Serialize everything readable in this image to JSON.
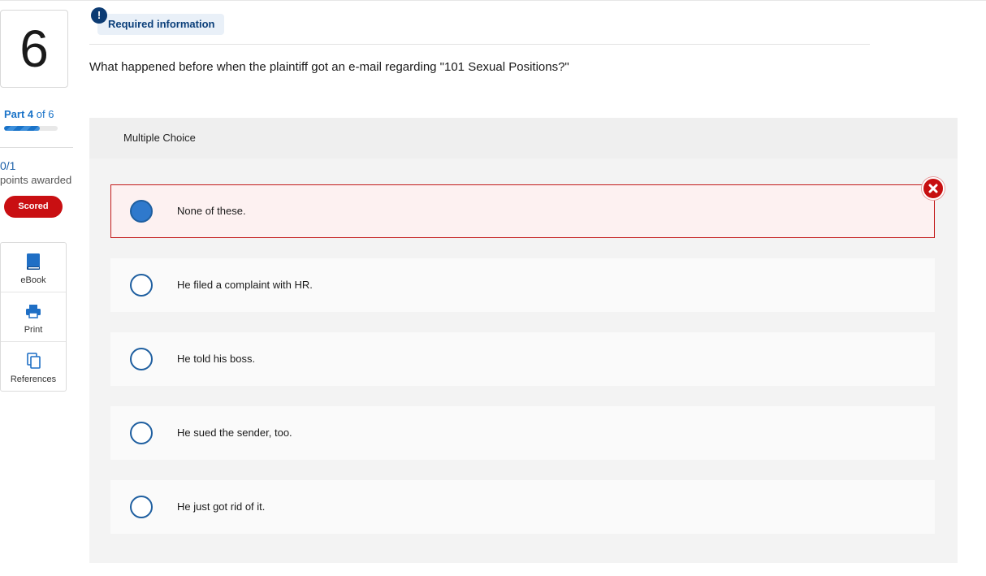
{
  "question": {
    "number": "6",
    "part_label_bold": "Part 4",
    "part_label_rest": " of 6",
    "part_progress": 0.67,
    "score": "0/1",
    "points_label": "points awarded",
    "scored_badge": "Scored",
    "required_info": "Required information",
    "text": "What happened before when the plaintiff got an e-mail regarding \"101 Sexual Positions?\""
  },
  "tools": [
    {
      "label": "eBook",
      "icon": "book-icon"
    },
    {
      "label": "Print",
      "icon": "printer-icon"
    },
    {
      "label": "References",
      "icon": "copy-icon"
    }
  ],
  "multiple_choice": {
    "header": "Multiple Choice",
    "options": [
      {
        "label": "None of these.",
        "selected": true,
        "status": "incorrect"
      },
      {
        "label": "He filed a complaint with HR.",
        "selected": false
      },
      {
        "label": "He told his boss.",
        "selected": false
      },
      {
        "label": "He sued the sender, too.",
        "selected": false
      },
      {
        "label": "He just got rid of it.",
        "selected": false
      }
    ]
  },
  "colors": {
    "accent_blue": "#1a73c8",
    "navy": "#0c3b73",
    "error_red": "#c90f12",
    "selected_radio": "#2f79cc"
  }
}
